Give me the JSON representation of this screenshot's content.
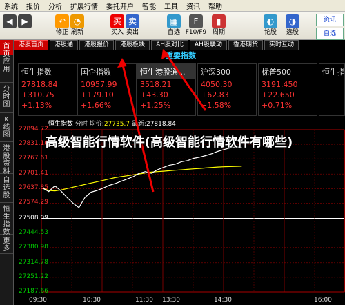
{
  "menu": [
    "系统",
    "报价",
    "分析",
    "扩展行情",
    "委托开户",
    "智能",
    "工具",
    "资讯",
    "帮助"
  ],
  "toolbar": [
    {
      "label": "修正",
      "icon": "back-arrow-icon",
      "color": "#f90"
    },
    {
      "label": "刷新",
      "icon": "refresh-clock-icon",
      "color": "#e90"
    },
    {
      "label": "买入",
      "icon": "buy-icon",
      "color": "#e00"
    },
    {
      "label": "卖出",
      "icon": "sell-icon",
      "color": "#36c"
    },
    {
      "label": "自选",
      "icon": "grid-icon",
      "color": "#39c"
    },
    {
      "label": "F10/F9",
      "icon": "f10-icon",
      "color": "#555"
    },
    {
      "label": "周期",
      "icon": "candle-icon",
      "color": "#c33"
    },
    {
      "label": "论股",
      "icon": "chat-icon",
      "color": "#39c"
    },
    {
      "label": "选股",
      "icon": "gauge-icon",
      "color": "#36c"
    }
  ],
  "right_buttons": [
    "资讯",
    "自选"
  ],
  "tabs": [
    "港股首页",
    "港股通",
    "港股报价",
    "港股板块",
    "AH股对比",
    "AH股联动",
    "香港期货",
    "实时互动"
  ],
  "sidebar": [
    "首页",
    "应用",
    "分时图",
    "K线图",
    "港股资料",
    "自选股",
    "恒生指数",
    "更多"
  ],
  "section_title": "重要指数",
  "cards": [
    {
      "name": "恒生指数",
      "value": "27818.84",
      "change": "+310.75",
      "pct": "+1.13%"
    },
    {
      "name": "国企指数",
      "value": "10957.99",
      "change": "+179.10",
      "pct": "+1.66%"
    },
    {
      "name": "恒生港股通...",
      "value": "3518.21",
      "change": "+43.30",
      "pct": "+1.25%"
    },
    {
      "name": "沪深300",
      "value": "4050.30",
      "change": "+62.83",
      "pct": "+1.58%"
    },
    {
      "name": "标普500",
      "value": "3191.450",
      "change": "+22.650",
      "pct": "+0.71%"
    },
    {
      "name": "恒生指数",
      "value": "",
      "change": "",
      "pct": ""
    }
  ],
  "infobar": {
    "name": "恒生指数",
    "series": "分时",
    "avg_label": "均价:",
    "avg": "27735.7",
    "latest_label": "最新:",
    "latest": "27818.84"
  },
  "chart_data": {
    "type": "line",
    "y_ticks": [
      "27894.72",
      "27831.16",
      "27767.61",
      "27701.41",
      "27637.85",
      "27574.29",
      "27508.09",
      "27444.53",
      "27380.98",
      "27314.78",
      "27251.22",
      "27187.66"
    ],
    "x_ticks": [
      "09:30",
      "10:30",
      "11:30",
      "13:30",
      "14:30",
      "16:00"
    ],
    "prev_close": 27508.09,
    "price_points": [
      27640,
      27625,
      27650,
      27628,
      27600,
      27575,
      27555,
      27600,
      27622,
      27630,
      27640,
      27652,
      27660,
      27670,
      27680,
      27690,
      27705,
      27712,
      27705,
      27720,
      27730,
      27740,
      27745,
      27755,
      27760,
      27770,
      27775,
      27782,
      27790,
      27800,
      27808,
      27815,
      27820,
      27818
    ],
    "avg_points": [
      27640,
      27630,
      27628,
      27632,
      27638,
      27644,
      27650,
      27656,
      27662,
      27668,
      27674,
      27680,
      27686,
      27690,
      27694,
      27698,
      27702,
      27706,
      27710,
      27712,
      27714,
      27716,
      27718,
      27720,
      27722,
      27724,
      27726,
      27728,
      27730,
      27732,
      27733,
      27734,
      27735,
      27735.7
    ]
  },
  "overlay_text": "高级智能行情软件(高级智能行情软件有哪些)"
}
